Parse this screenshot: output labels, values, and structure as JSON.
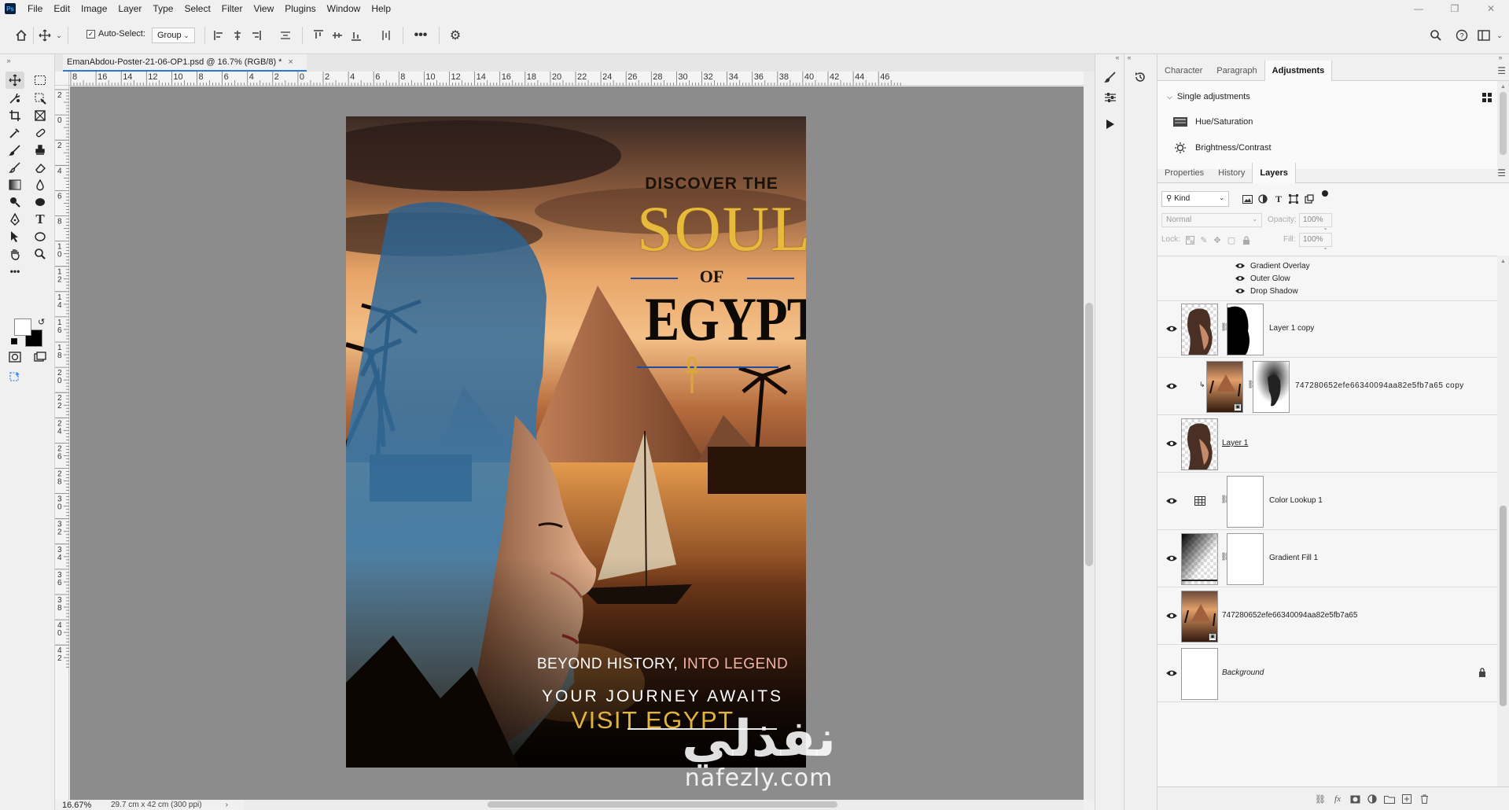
{
  "menu": {
    "items": [
      "File",
      "Edit",
      "Image",
      "Layer",
      "Type",
      "Select",
      "Filter",
      "View",
      "Plugins",
      "Window",
      "Help"
    ]
  },
  "options": {
    "autoselect_label": "Auto-Select:",
    "group_value": "Group"
  },
  "document": {
    "tab_title": "EmanAbdou-Poster-21-06-OP1.psd @ 16.7% (RGB/8) *",
    "close_glyph": "×",
    "zoom": "16.67%",
    "size_info": "29.7 cm x 42 cm (300 ppi)",
    "ruler_h": [
      "8",
      "16",
      "14",
      "12",
      "10",
      "8",
      "6",
      "4",
      "2",
      "0",
      "2",
      "4",
      "6",
      "8",
      "10",
      "12",
      "14",
      "16",
      "18",
      "20",
      "22",
      "24",
      "26",
      "28",
      "30",
      "32",
      "34",
      "36",
      "38",
      "40",
      "42",
      "44",
      "46"
    ],
    "ruler_v": [
      "2",
      "0",
      "2",
      "4",
      "6",
      "8",
      "10",
      "12",
      "14",
      "16",
      "18",
      "20",
      "22",
      "24",
      "26",
      "28",
      "30",
      "32",
      "34",
      "36",
      "38",
      "40",
      "42"
    ]
  },
  "poster": {
    "discover": "DISCOVER THE",
    "soul": "SOUL",
    "of": "OF",
    "egypt": "EGYPT",
    "beyond_a": "BEYOND HISTORY, ",
    "beyond_b": "INTO LEGEND",
    "journey": "YOUR JOURNEY AWAITS",
    "visit": "VISIT EGYPT"
  },
  "watermark": {
    "arabic": "نفذلي",
    "latin": "nafezly.com"
  },
  "panels": {
    "top_tabs": [
      "Character",
      "Paragraph",
      "Adjustments"
    ],
    "single_adjustments": "Single adjustments",
    "adjustments": [
      "Hue/Saturation",
      "Brightness/Contrast"
    ],
    "layer_tabs": [
      "Properties",
      "History",
      "Layers"
    ],
    "filter_kind": "Kind",
    "blend_mode": "Normal",
    "opacity_label": "Opacity:",
    "opacity_value": "100%",
    "lock_label": "Lock:",
    "fill_label": "Fill:",
    "fill_value": "100%"
  },
  "layers": {
    "effects": [
      "Gradient Overlay",
      "Outer Glow",
      "Drop Shadow"
    ],
    "rows": [
      {
        "name": "Layer 1 copy"
      },
      {
        "name": "747280652efe66340094aa82e5fb7a65 copy"
      },
      {
        "name": "Layer 1"
      },
      {
        "name": "Color Lookup 1"
      },
      {
        "name": "Gradient Fill 1"
      },
      {
        "name": "747280652efe66340094aa82e5fb7a65"
      },
      {
        "name": "Background"
      }
    ]
  }
}
